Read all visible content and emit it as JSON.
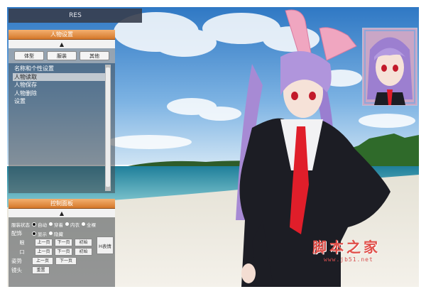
{
  "window": {
    "title": "RES"
  },
  "character_panel": {
    "header": "人物设置",
    "collapse_icon": "▲",
    "tabs": [
      "体型",
      "服装",
      "其他"
    ],
    "items": [
      "名称和个性设置",
      "人物读取",
      "人物保存",
      "人物删除",
      "设置"
    ],
    "selected_index": 1
  },
  "control_panel": {
    "header": "控制面板",
    "collapse_icon": "▲",
    "clothing_state": {
      "label": "服装状态",
      "options": [
        "自动",
        "穿着",
        "内衣",
        "全裸"
      ]
    },
    "accessory": {
      "label": "配饰",
      "options": [
        "显示",
        "隐藏"
      ]
    },
    "eyes": {
      "label": "眼",
      "buttons": [
        "上一页",
        "下一页",
        "初始"
      ]
    },
    "mouth": {
      "label": "口",
      "buttons": [
        "上一页",
        "下一页",
        "初始"
      ]
    },
    "h_expression_button": "H表情",
    "pose": {
      "label": "姿势",
      "buttons": [
        "上一页",
        "下一页"
      ]
    },
    "camera": {
      "label": "镜头",
      "buttons": [
        "重置"
      ]
    }
  },
  "watermark": {
    "text": "脚本之家",
    "url": "www.jb51.net"
  },
  "colors": {
    "panel_header": "#e08a3c",
    "sky": "#4f8fd0",
    "sea": "#2e9bb0",
    "sand": "#ece9df",
    "hair": "#a98bd6"
  }
}
